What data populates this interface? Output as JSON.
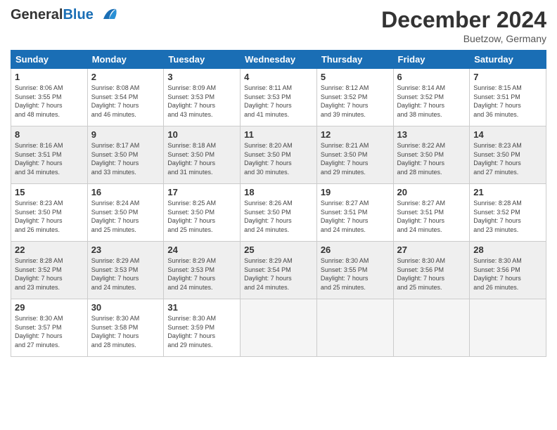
{
  "header": {
    "logo_line1": "General",
    "logo_line2": "Blue",
    "month": "December 2024",
    "location": "Buetzow, Germany"
  },
  "weekdays": [
    "Sunday",
    "Monday",
    "Tuesday",
    "Wednesday",
    "Thursday",
    "Friday",
    "Saturday"
  ],
  "weeks": [
    [
      {
        "day": "1",
        "info": "Sunrise: 8:06 AM\nSunset: 3:55 PM\nDaylight: 7 hours\nand 48 minutes."
      },
      {
        "day": "2",
        "info": "Sunrise: 8:08 AM\nSunset: 3:54 PM\nDaylight: 7 hours\nand 46 minutes."
      },
      {
        "day": "3",
        "info": "Sunrise: 8:09 AM\nSunset: 3:53 PM\nDaylight: 7 hours\nand 43 minutes."
      },
      {
        "day": "4",
        "info": "Sunrise: 8:11 AM\nSunset: 3:53 PM\nDaylight: 7 hours\nand 41 minutes."
      },
      {
        "day": "5",
        "info": "Sunrise: 8:12 AM\nSunset: 3:52 PM\nDaylight: 7 hours\nand 39 minutes."
      },
      {
        "day": "6",
        "info": "Sunrise: 8:14 AM\nSunset: 3:52 PM\nDaylight: 7 hours\nand 38 minutes."
      },
      {
        "day": "7",
        "info": "Sunrise: 8:15 AM\nSunset: 3:51 PM\nDaylight: 7 hours\nand 36 minutes."
      }
    ],
    [
      {
        "day": "8",
        "info": "Sunrise: 8:16 AM\nSunset: 3:51 PM\nDaylight: 7 hours\nand 34 minutes."
      },
      {
        "day": "9",
        "info": "Sunrise: 8:17 AM\nSunset: 3:50 PM\nDaylight: 7 hours\nand 33 minutes."
      },
      {
        "day": "10",
        "info": "Sunrise: 8:18 AM\nSunset: 3:50 PM\nDaylight: 7 hours\nand 31 minutes."
      },
      {
        "day": "11",
        "info": "Sunrise: 8:20 AM\nSunset: 3:50 PM\nDaylight: 7 hours\nand 30 minutes."
      },
      {
        "day": "12",
        "info": "Sunrise: 8:21 AM\nSunset: 3:50 PM\nDaylight: 7 hours\nand 29 minutes."
      },
      {
        "day": "13",
        "info": "Sunrise: 8:22 AM\nSunset: 3:50 PM\nDaylight: 7 hours\nand 28 minutes."
      },
      {
        "day": "14",
        "info": "Sunrise: 8:23 AM\nSunset: 3:50 PM\nDaylight: 7 hours\nand 27 minutes."
      }
    ],
    [
      {
        "day": "15",
        "info": "Sunrise: 8:23 AM\nSunset: 3:50 PM\nDaylight: 7 hours\nand 26 minutes."
      },
      {
        "day": "16",
        "info": "Sunrise: 8:24 AM\nSunset: 3:50 PM\nDaylight: 7 hours\nand 25 minutes."
      },
      {
        "day": "17",
        "info": "Sunrise: 8:25 AM\nSunset: 3:50 PM\nDaylight: 7 hours\nand 25 minutes."
      },
      {
        "day": "18",
        "info": "Sunrise: 8:26 AM\nSunset: 3:50 PM\nDaylight: 7 hours\nand 24 minutes."
      },
      {
        "day": "19",
        "info": "Sunrise: 8:27 AM\nSunset: 3:51 PM\nDaylight: 7 hours\nand 24 minutes."
      },
      {
        "day": "20",
        "info": "Sunrise: 8:27 AM\nSunset: 3:51 PM\nDaylight: 7 hours\nand 24 minutes."
      },
      {
        "day": "21",
        "info": "Sunrise: 8:28 AM\nSunset: 3:52 PM\nDaylight: 7 hours\nand 23 minutes."
      }
    ],
    [
      {
        "day": "22",
        "info": "Sunrise: 8:28 AM\nSunset: 3:52 PM\nDaylight: 7 hours\nand 23 minutes."
      },
      {
        "day": "23",
        "info": "Sunrise: 8:29 AM\nSunset: 3:53 PM\nDaylight: 7 hours\nand 24 minutes."
      },
      {
        "day": "24",
        "info": "Sunrise: 8:29 AM\nSunset: 3:53 PM\nDaylight: 7 hours\nand 24 minutes."
      },
      {
        "day": "25",
        "info": "Sunrise: 8:29 AM\nSunset: 3:54 PM\nDaylight: 7 hours\nand 24 minutes."
      },
      {
        "day": "26",
        "info": "Sunrise: 8:30 AM\nSunset: 3:55 PM\nDaylight: 7 hours\nand 25 minutes."
      },
      {
        "day": "27",
        "info": "Sunrise: 8:30 AM\nSunset: 3:56 PM\nDaylight: 7 hours\nand 25 minutes."
      },
      {
        "day": "28",
        "info": "Sunrise: 8:30 AM\nSunset: 3:56 PM\nDaylight: 7 hours\nand 26 minutes."
      }
    ],
    [
      {
        "day": "29",
        "info": "Sunrise: 8:30 AM\nSunset: 3:57 PM\nDaylight: 7 hours\nand 27 minutes."
      },
      {
        "day": "30",
        "info": "Sunrise: 8:30 AM\nSunset: 3:58 PM\nDaylight: 7 hours\nand 28 minutes."
      },
      {
        "day": "31",
        "info": "Sunrise: 8:30 AM\nSunset: 3:59 PM\nDaylight: 7 hours\nand 29 minutes."
      },
      null,
      null,
      null,
      null
    ]
  ]
}
